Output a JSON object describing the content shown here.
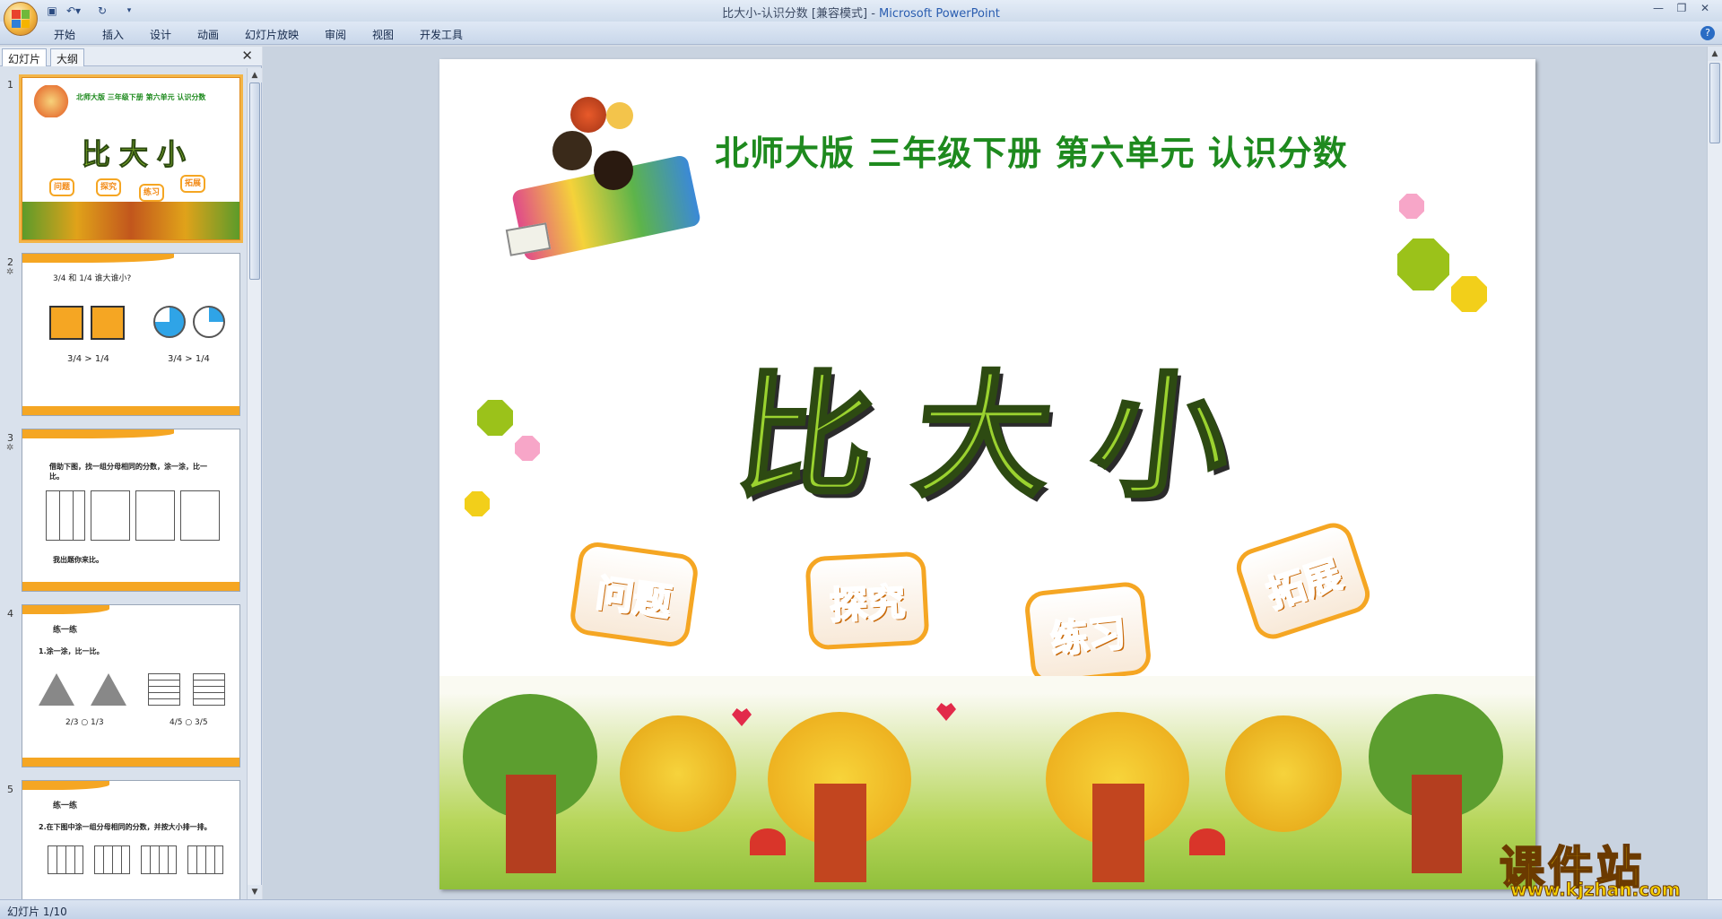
{
  "window": {
    "title_doc": "比大小-认识分数 [兼容模式] - ",
    "title_app": "Microsoft PowerPoint"
  },
  "ribbon_tabs": [
    "开始",
    "插入",
    "设计",
    "动画",
    "幻灯片放映",
    "审阅",
    "视图",
    "开发工具"
  ],
  "left_pane": {
    "tabs": [
      "幻灯片",
      "大纲"
    ],
    "slides": [
      {
        "num": "1",
        "title": "比大小",
        "header": "北师大版  三年级下册  第六单元     认识分数",
        "buttons": [
          "问题",
          "探究",
          "练习",
          "拓展"
        ]
      },
      {
        "num": "2",
        "prompt": "3/4 和 1/4 谁大谁小?",
        "compare_left": "3/4 > 1/4",
        "compare_right": "3/4 > 1/4"
      },
      {
        "num": "3",
        "prompt": "借助下图，找一组分母相同的分数，涂一涂，比一比。",
        "footer": "我出题你来比。"
      },
      {
        "num": "4",
        "tag": "练一练",
        "prompt": "1.涂一涂，比一比。",
        "cmp1": "2/3 ○ 1/3",
        "cmp2": "4/5 ○ 3/5"
      },
      {
        "num": "5",
        "tag": "练一练",
        "prompt": "2.在下图中涂一组分母相同的分数，并按大小排一排。"
      }
    ]
  },
  "slide": {
    "header": "北师大版  三年级下册  第六单元     认识分数",
    "title": "比大小",
    "buttons": [
      "问题",
      "探究",
      "练习",
      "拓展"
    ]
  },
  "status": {
    "text": "幻灯片 1/10"
  },
  "watermark": {
    "cn": "课件站",
    "url": "www.kjzhan.com"
  },
  "colors": {
    "green_title": "#9bd22f",
    "header_green": "#1e8a1e",
    "badge_orange": "#f5a623",
    "pink": "#f7a6c8",
    "lime": "#9bc21a",
    "yellow": "#f2cf1a"
  }
}
